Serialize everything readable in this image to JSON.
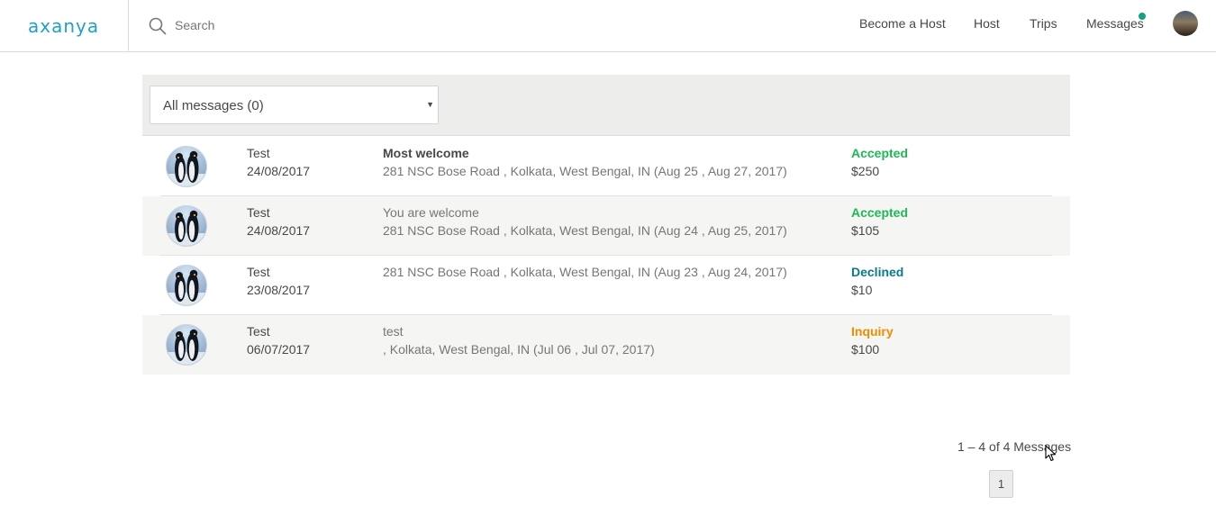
{
  "app": {
    "logo": "axanya"
  },
  "search": {
    "placeholder": "Search"
  },
  "nav": {
    "become_host": "Become a Host",
    "host": "Host",
    "trips": "Trips",
    "messages": "Messages"
  },
  "colors": {
    "accent": "#1ea3c4",
    "accepted": "#1db954",
    "declined": "#0b7a8a",
    "inquiry": "#f08c00",
    "notification": "#16a085"
  },
  "filter": {
    "selected": "All messages (0)"
  },
  "messages": [
    {
      "name": "Test",
      "date": "24/08/2017",
      "subject": "Most welcome",
      "address": "281 NSC Bose Road , Kolkata, West Bengal, IN (Aug 25 , Aug 27, 2017)",
      "status": "Accepted",
      "price": "$250"
    },
    {
      "name": "Test",
      "date": "24/08/2017",
      "subject": "You are welcome",
      "address": "281 NSC Bose Road , Kolkata, West Bengal, IN (Aug 24 , Aug 25, 2017)",
      "status": "Accepted",
      "price": "$105"
    },
    {
      "name": "Test",
      "date": "23/08/2017",
      "subject": "",
      "address": "281 NSC Bose Road , Kolkata, West Bengal, IN (Aug 23 , Aug 24, 2017)",
      "status": "Declined",
      "price": "$10"
    },
    {
      "name": "Test",
      "date": "06/07/2017",
      "subject": "test",
      "address": ", Kolkata, West Bengal, IN (Jul 06 , Jul 07, 2017)",
      "status": "Inquiry",
      "price": "$100"
    }
  ],
  "pagination": {
    "summary": "1 – 4 of 4 Messages",
    "current_page": "1"
  }
}
